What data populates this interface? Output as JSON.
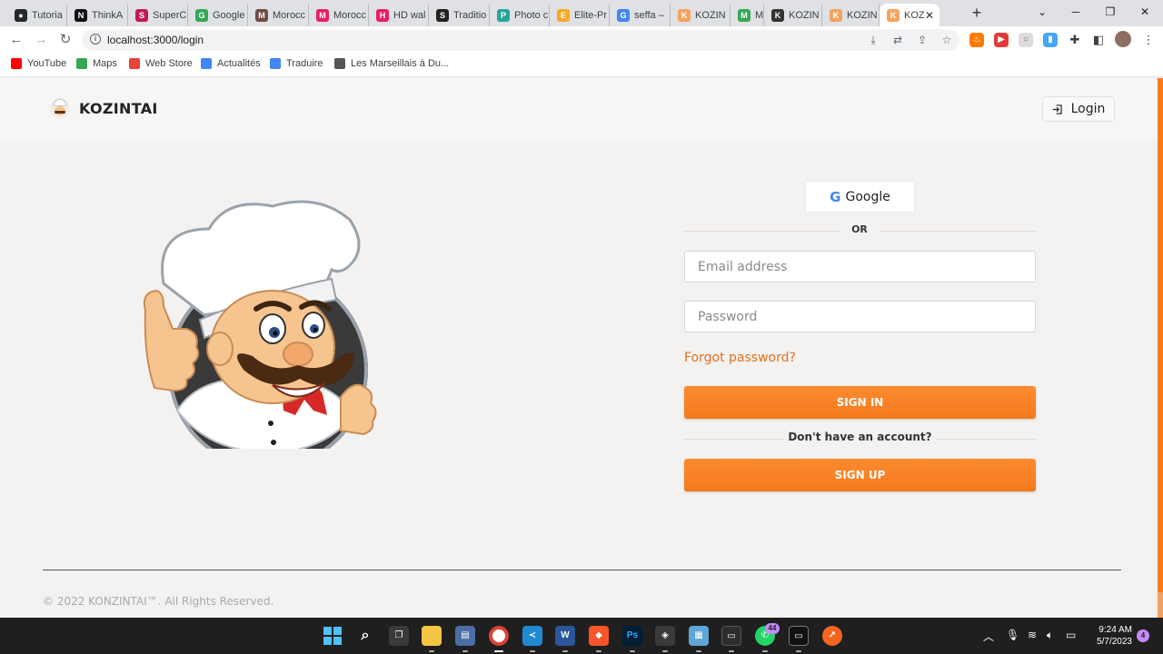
{
  "browser": {
    "tabs": [
      {
        "label": "Tutoria",
        "color": "#24292f",
        "glyph": "●"
      },
      {
        "label": "ThinkA",
        "color": "#111111",
        "glyph": "N"
      },
      {
        "label": "SuperC",
        "color": "#c2185b",
        "glyph": "S"
      },
      {
        "label": "Google",
        "color": "#34a853",
        "glyph": "G"
      },
      {
        "label": "Morocc",
        "color": "#6d4c41",
        "glyph": "M"
      },
      {
        "label": "Morocc",
        "color": "#e91e63",
        "glyph": "M"
      },
      {
        "label": "HD wal",
        "color": "#e91e63",
        "glyph": "H"
      },
      {
        "label": "Traditio",
        "color": "#222222",
        "glyph": "S"
      },
      {
        "label": "Photo c",
        "color": "#26a69a",
        "glyph": "P"
      },
      {
        "label": "Elite-Pr",
        "color": "#f9a825",
        "glyph": "E"
      },
      {
        "label": "seffa –",
        "color": "#4285f4",
        "glyph": "G"
      },
      {
        "label": "KOZIN",
        "color": "#f4a460",
        "glyph": "K"
      },
      {
        "label": "Me",
        "color": "#34a853",
        "glyph": "M"
      },
      {
        "label": "KOZIN",
        "color": "#333333",
        "glyph": "K"
      },
      {
        "label": "KOZIN",
        "color": "#f4a460",
        "glyph": "K"
      },
      {
        "label": "KOZ",
        "color": "#f4a460",
        "glyph": "K"
      }
    ],
    "active_tab_close": "✕",
    "new_tab": "+",
    "url": "localhost:3000/login",
    "bookmarks": [
      {
        "label": "YouTube",
        "color": "#ff0000"
      },
      {
        "label": "Maps",
        "color": "#34a853"
      },
      {
        "label": "Web Store",
        "color": "#ea4335"
      },
      {
        "label": "Actualités",
        "color": "#4285f4"
      },
      {
        "label": "Traduire",
        "color": "#4285f4"
      },
      {
        "label": "Les Marseillais à Du...",
        "color": "#555555"
      }
    ]
  },
  "app": {
    "brand": "KOZINTAI",
    "login_label": "Login",
    "google_label": "Google",
    "or_label": "OR",
    "email_placeholder": "Email address",
    "password_placeholder": "Password",
    "forgot_label": "Forgot password?",
    "signin_label": "SIGN IN",
    "no_account_label": "Don't have an account?",
    "signup_label": "SIGN UP",
    "copyright": "© 2022 KONZINTAI™. All Rights Reserved.",
    "accent_color": "#f57c1f"
  },
  "taskbar": {
    "time": "9:24 AM",
    "date": "5/7/2023",
    "whatsapp_badge": "44",
    "notifications": "4"
  }
}
